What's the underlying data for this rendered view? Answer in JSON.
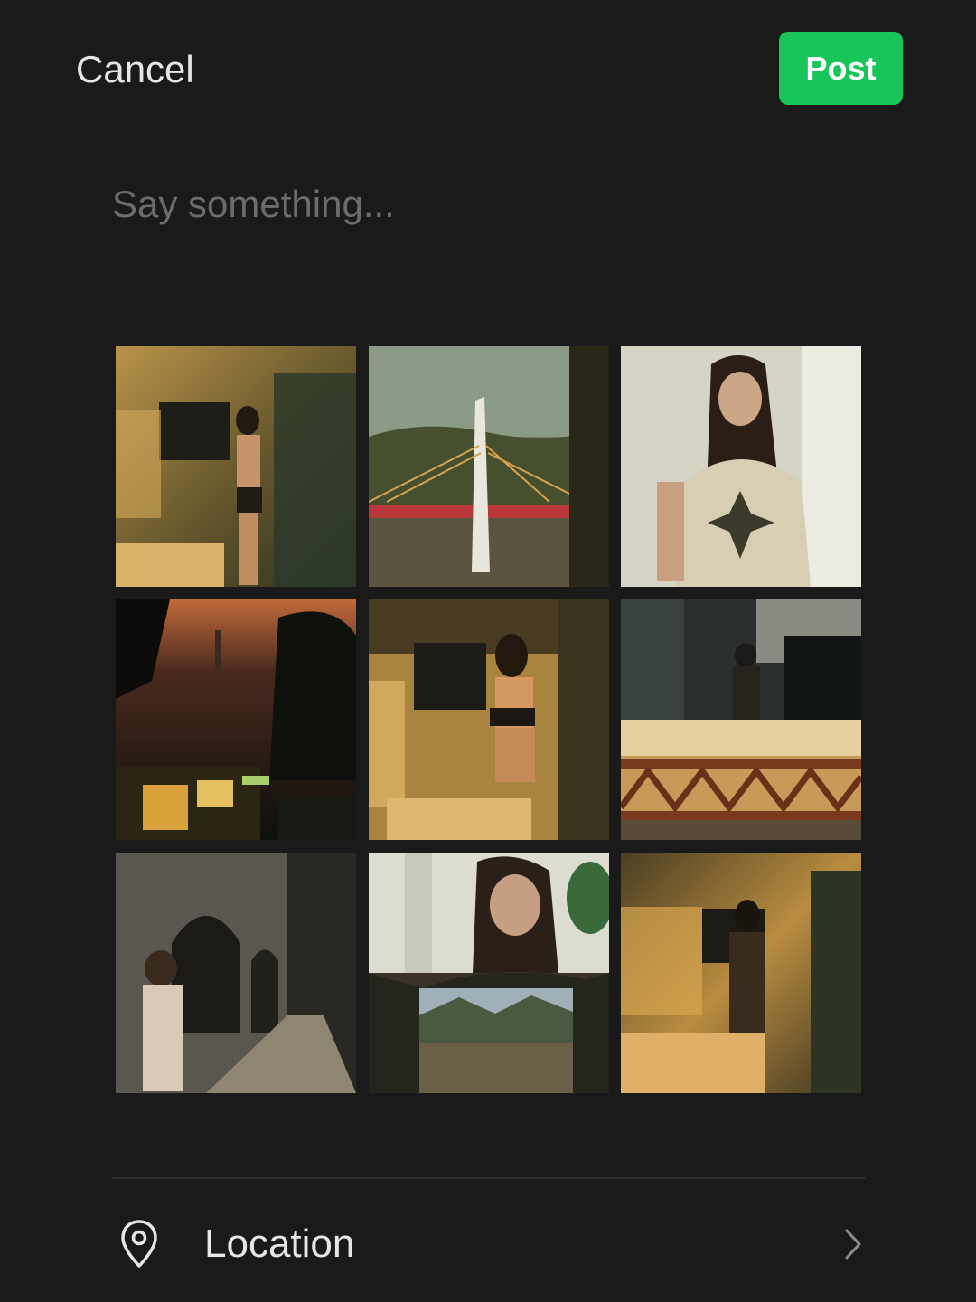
{
  "header": {
    "cancel_label": "Cancel",
    "post_label": "Post"
  },
  "composer": {
    "placeholder": "Say something...",
    "value": ""
  },
  "photos": [
    {
      "name": "photo-girl-kitchen"
    },
    {
      "name": "photo-bridge-pylon"
    },
    {
      "name": "photo-woman-glasses"
    },
    {
      "name": "photo-dusk-street"
    },
    {
      "name": "photo-girl-kitchen-closeup"
    },
    {
      "name": "photo-city-bridge-collage"
    },
    {
      "name": "photo-alley-arches"
    },
    {
      "name": "photo-woman-mountains-collage"
    },
    {
      "name": "photo-kitchen-silhouette"
    }
  ],
  "location": {
    "label": "Location",
    "icon": "map-pin-icon",
    "chevron": "chevron-right-icon"
  },
  "colors": {
    "background": "#1a1a1b",
    "accent": "#17c55a",
    "placeholder": "#6c6c6e",
    "divider": "#2c2c2e"
  }
}
